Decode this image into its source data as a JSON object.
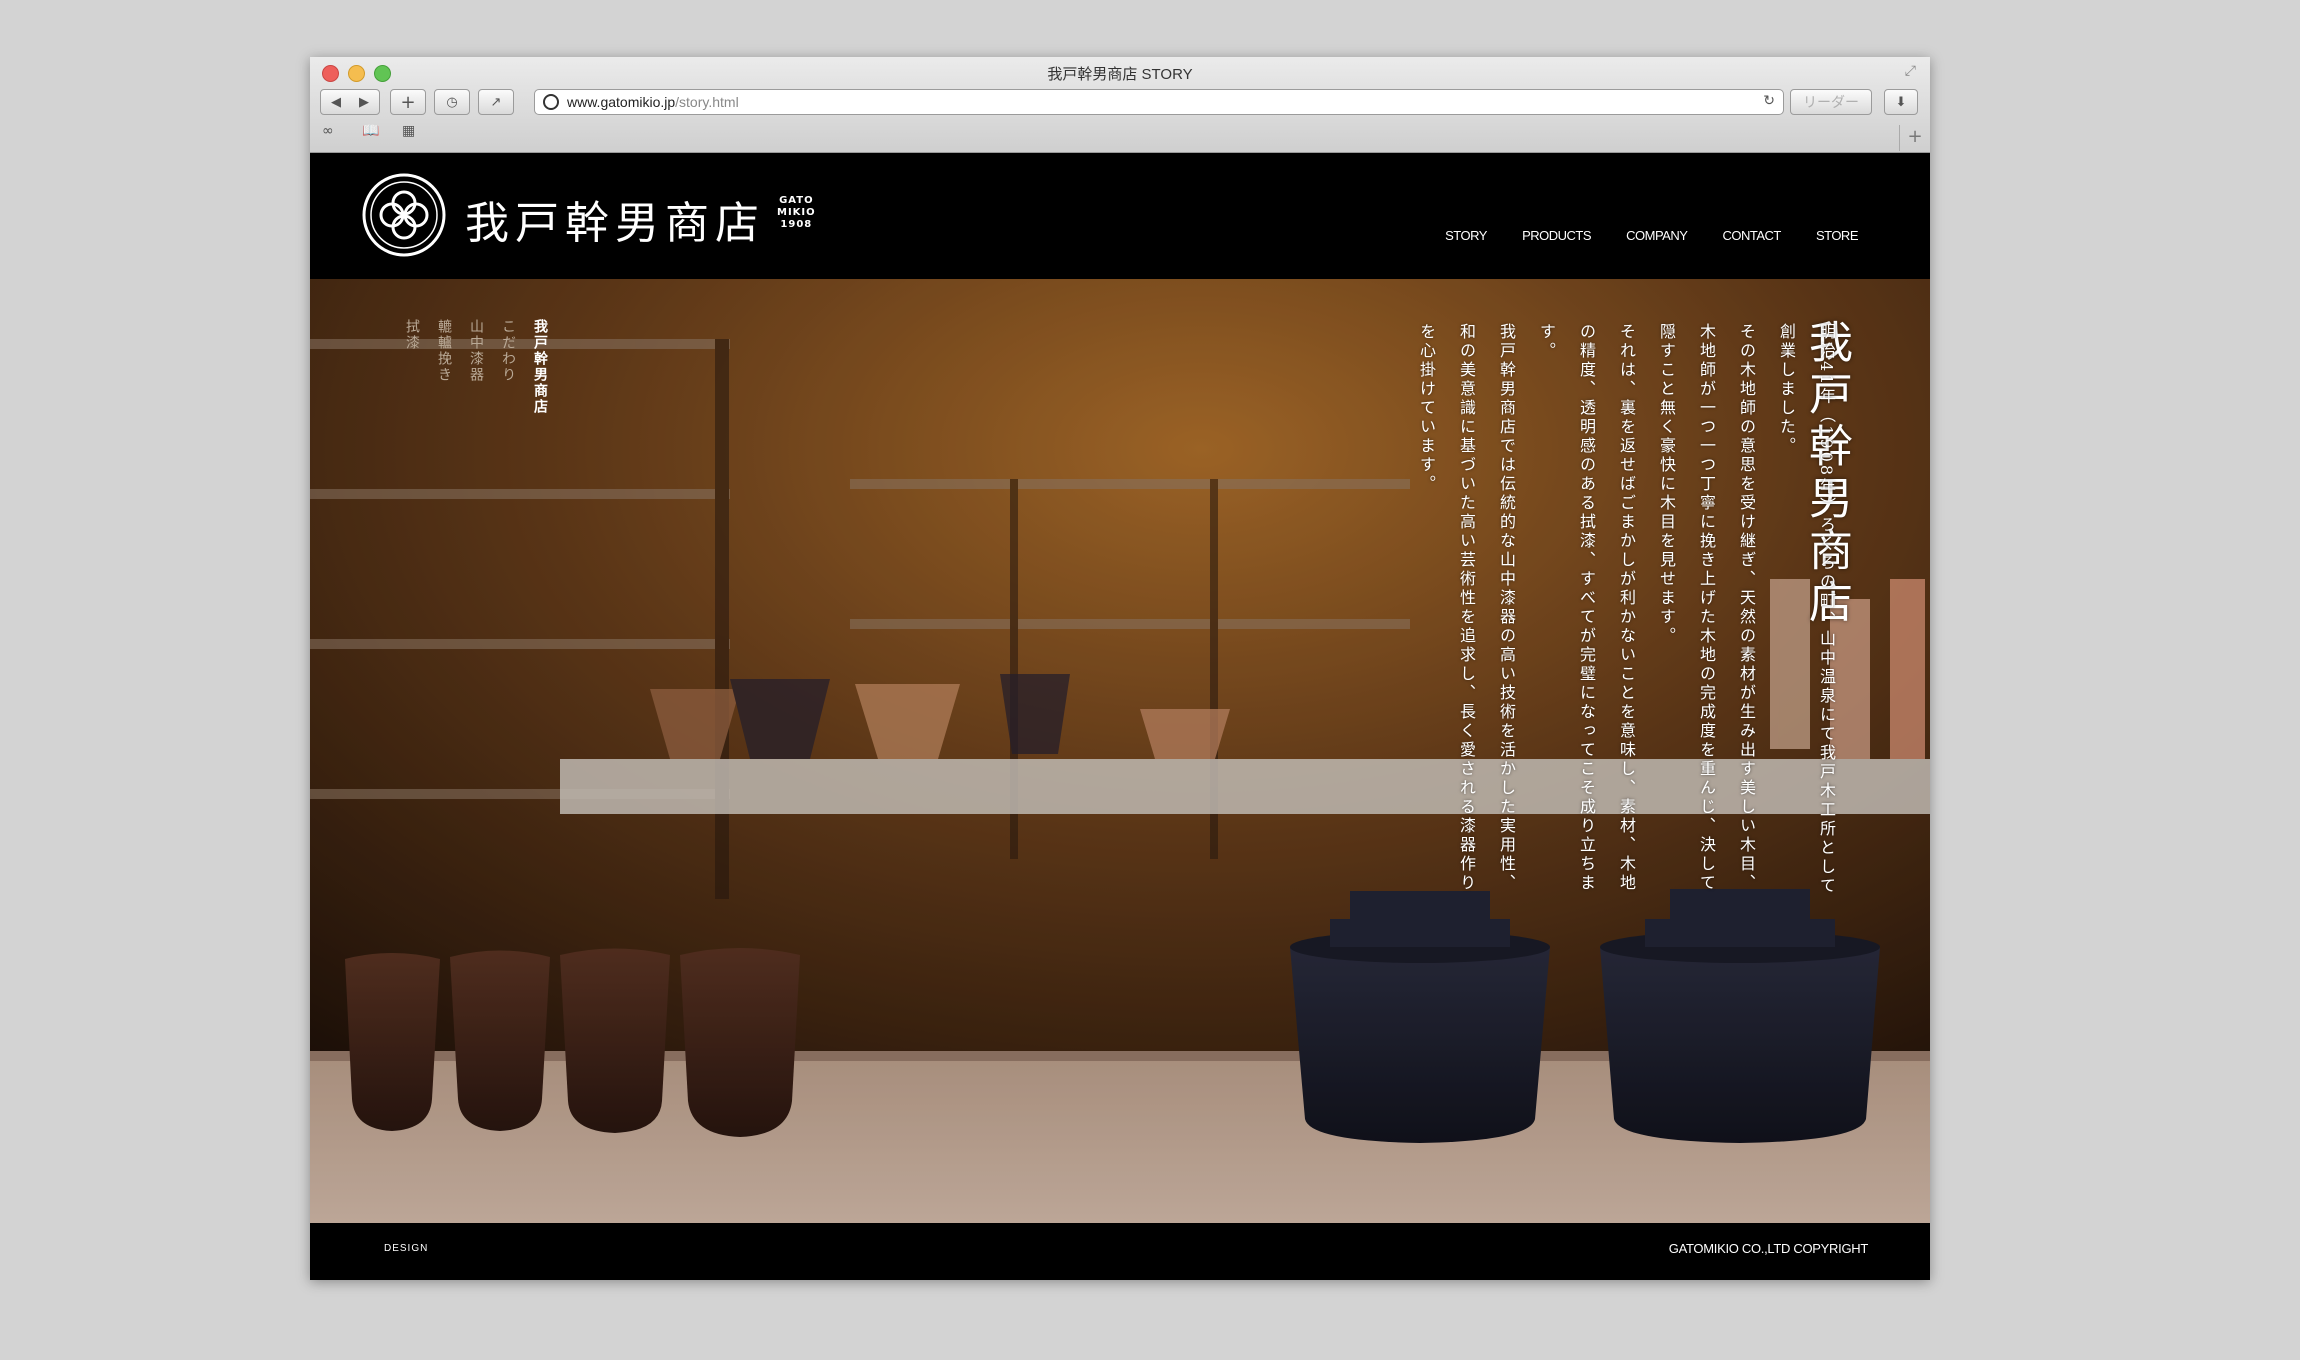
{
  "browser": {
    "window_title": "我戸幹男商店 STORY",
    "url_host": "www.gatomikio.jp",
    "url_path": "/story.html",
    "reader_label": "リーダー"
  },
  "site": {
    "logo_name": "我戸幹男商店",
    "logo_sub": [
      "GATO",
      "MIKIO",
      "1908"
    ],
    "nav": [
      "STORY",
      "PRODUCTS",
      "COMPANY",
      "CONTACT",
      "STORE"
    ]
  },
  "hero": {
    "heading": "我戸幹男商店",
    "story_paragraphs": [
      "明治41年（1908年）ろくろの町、山中温泉にて我戸木工所として創業しました。",
      "その木地師の意思を受け継ぎ、天然の素材が生み出す美しい木目、木地師が一つ一つ丁寧に挽き上げた木地の完成度を重んじ、決して隠すこと無く豪快に木目を見せます。",
      "それは、裏を返せばごまかしが利かないことを意味し、素材、木地の精度、透明感のある拭漆、すべてが完璧になってこそ成り立ちます。",
      "我戸幹男商店では伝統的な山中漆器の高い技術を活かした実用性、和の美意識に基づいた高い芸術性を追求し、長く愛される漆器作りを心掛けています。"
    ],
    "sub_nav": [
      "我戸幹男商店",
      "こだわり",
      "山中漆器",
      "轆轤挽き",
      "拭漆"
    ]
  },
  "footer": {
    "design_label": "DESIGN",
    "copyright": "GATOMIKIO CO.,LTD COPYRIGHT"
  }
}
